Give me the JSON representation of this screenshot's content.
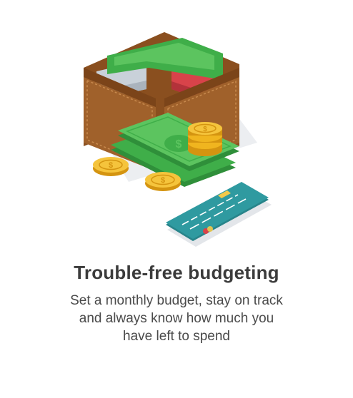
{
  "feature": {
    "title": "Trouble-free budgeting",
    "description_lines": [
      "Set a monthly budget, stay on track",
      "and always know how much you",
      "have left to spend"
    ]
  },
  "illustration": {
    "icons": [
      "wallet-icon",
      "banknote-icon",
      "coin-icon",
      "credit-card-icon"
    ],
    "colors": {
      "wallet": "#a0612b",
      "wallet_dark": "#7b4419",
      "banknote": "#3fae49",
      "banknote_light": "#5cc45f",
      "coin": "#f0b51f",
      "coin_dark": "#d49410",
      "card": "#2f9aa0",
      "card_stripe": "#ffffff",
      "card_chip": "#f3c94a",
      "red_card": "#d8434a",
      "grey_card": "#c9d1d9",
      "shadow": "#e3e6ea"
    }
  }
}
